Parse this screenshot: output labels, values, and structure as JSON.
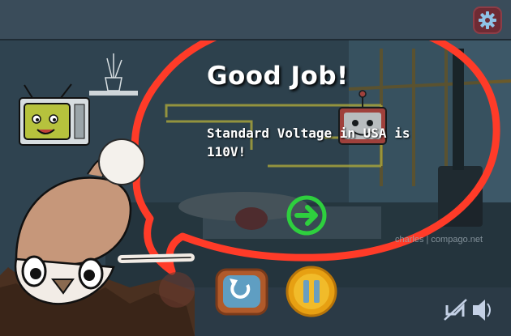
{
  "feedback": {
    "title": "Good Job!",
    "message": "Standard Voltage in USA is 110V!"
  },
  "photo_credit": "charles | compago.net",
  "colors": {
    "bubble_border": "#ff3b28",
    "next_button": "#2ecf3e",
    "replay_button": "#b05a2a",
    "pause_button": "#e7a012",
    "settings_button": "#6e2b34"
  },
  "icons": {
    "settings": "gear-icon",
    "next": "arrow-right-icon",
    "replay": "replay-icon",
    "pause": "pause-icon",
    "music": "music-muted-icon",
    "sound": "speaker-icon"
  }
}
